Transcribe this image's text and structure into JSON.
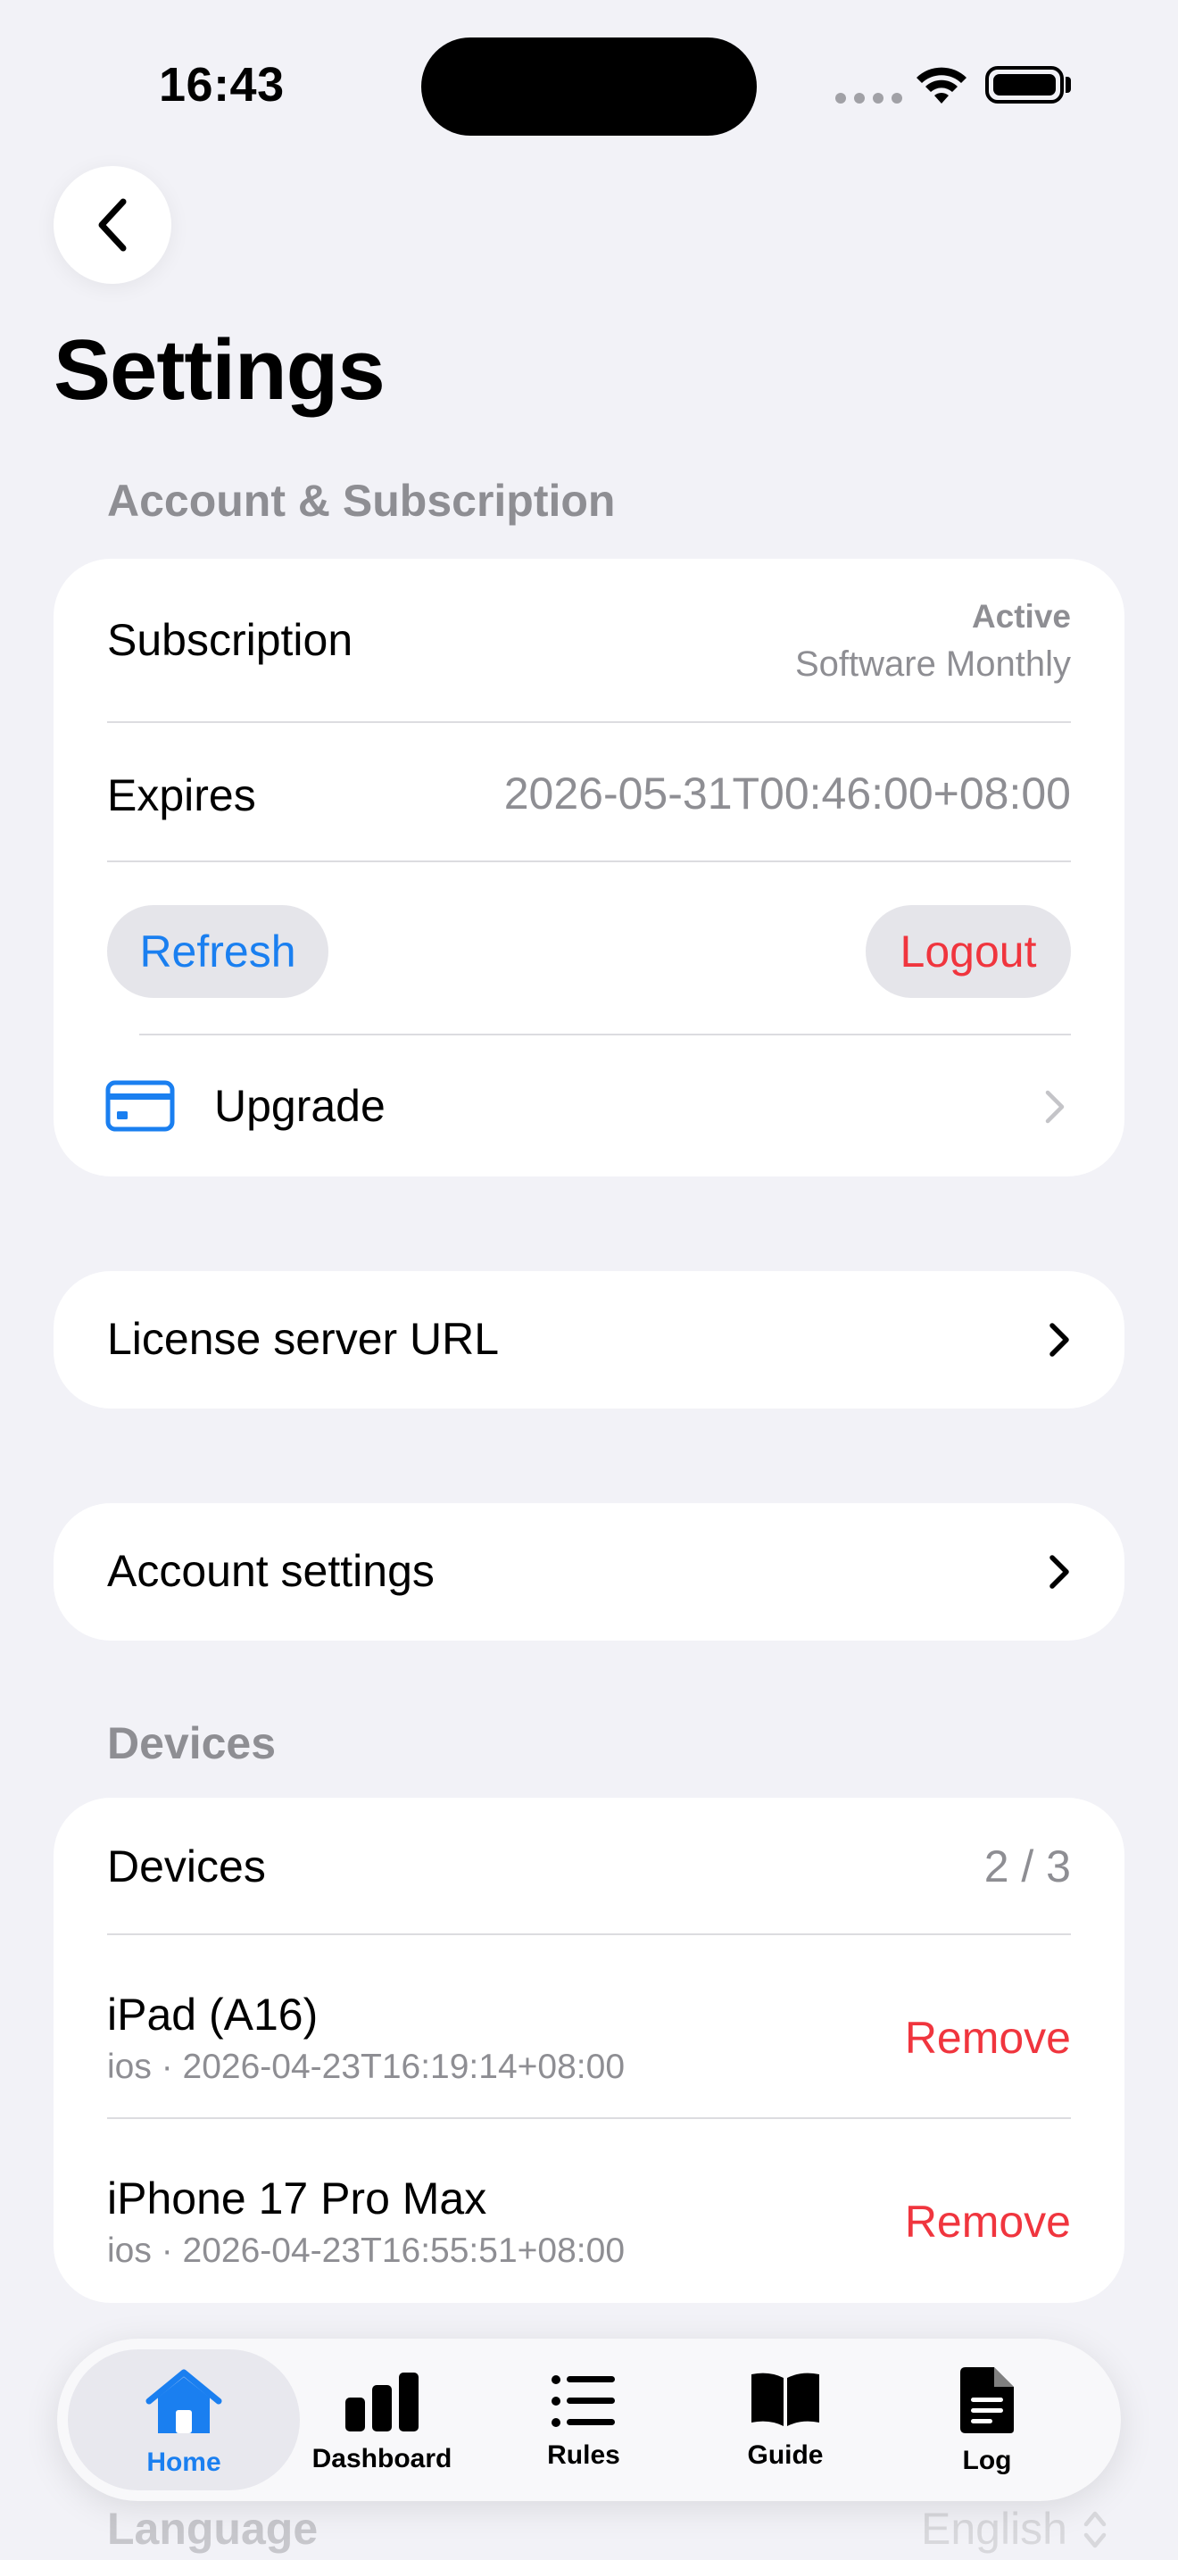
{
  "status_bar": {
    "time": "16:43"
  },
  "header": {
    "title": "Settings"
  },
  "account_section": {
    "header": "Account & Subscription",
    "subscription": {
      "label": "Subscription",
      "status": "Active",
      "plan": "Software Monthly"
    },
    "expires": {
      "label": "Expires",
      "value": "2026-05-31T00:46:00+08:00"
    },
    "refresh_label": "Refresh",
    "logout_label": "Logout",
    "upgrade_label": "Upgrade"
  },
  "license_server": {
    "label": "License server URL"
  },
  "account_settings": {
    "label": "Account settings"
  },
  "devices_section": {
    "header": "Devices",
    "summary": {
      "label": "Devices",
      "count": "2 / 3"
    },
    "items": [
      {
        "name": "iPad (A16)",
        "detail": "ios · 2026-04-23T16:19:14+08:00",
        "action": "Remove"
      },
      {
        "name": "iPhone 17 Pro Max",
        "detail": "ios · 2026-04-23T16:55:51+08:00",
        "action": "Remove"
      }
    ]
  },
  "language": {
    "label": "Language",
    "value": "English"
  },
  "tab_bar": {
    "tabs": [
      {
        "label": "Home",
        "icon": "house-icon",
        "active": true
      },
      {
        "label": "Dashboard",
        "icon": "bar-chart-icon",
        "active": false
      },
      {
        "label": "Rules",
        "icon": "list-icon",
        "active": false
      },
      {
        "label": "Guide",
        "icon": "book-icon",
        "active": false
      },
      {
        "label": "Log",
        "icon": "document-icon",
        "active": false
      }
    ]
  },
  "colors": {
    "accent": "#1a7ff0",
    "destructive": "#f0353e",
    "background": "#f2f2f7",
    "secondary_text": "#8e8e93"
  }
}
